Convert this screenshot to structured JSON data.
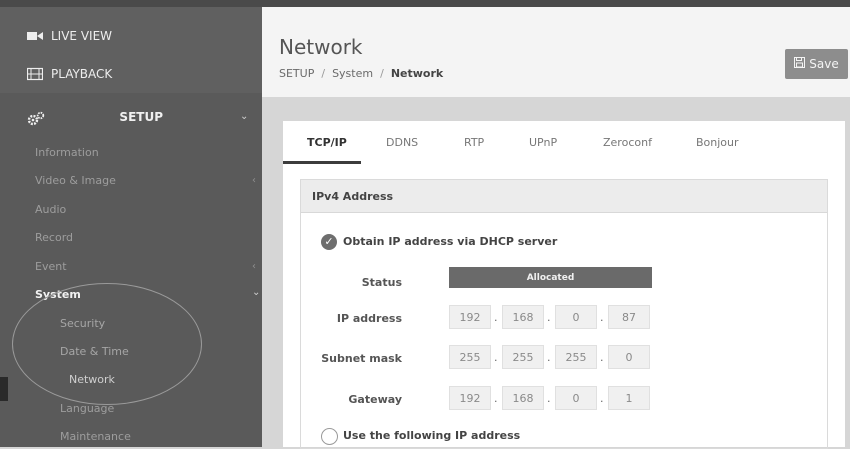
{
  "sidebar": {
    "live_view": "LIVE VIEW",
    "playback": "PLAYBACK",
    "setup": "SETUP",
    "items": [
      {
        "label": "Information"
      },
      {
        "label": "Video & Image"
      },
      {
        "label": "Audio"
      },
      {
        "label": "Record"
      },
      {
        "label": "Event"
      },
      {
        "label": "System"
      }
    ],
    "system_items": [
      {
        "label": "Security"
      },
      {
        "label": "Date & Time"
      },
      {
        "label": "Network"
      }
    ],
    "after": [
      {
        "label": "Language"
      },
      {
        "label": "Maintenance"
      }
    ]
  },
  "header": {
    "title": "Network",
    "breadcrumb": [
      "SETUP",
      "System",
      "Network"
    ],
    "save_label": "Save"
  },
  "tabs": [
    "TCP/IP",
    "DDNS",
    "RTP",
    "UPnP",
    "Zeroconf",
    "Bonjour"
  ],
  "ipv4": {
    "heading": "IPv4 Address",
    "dhcp_label": "Obtain IP address via DHCP server",
    "status_label": "Status",
    "status_value": "Allocated",
    "ip_label": "IP address",
    "ip": [
      "192",
      "168",
      "0",
      "87"
    ],
    "subnet_label": "Subnet mask",
    "subnet": [
      "255",
      "255",
      "255",
      "0"
    ],
    "gateway_label": "Gateway",
    "gateway": [
      "192",
      "168",
      "0",
      "1"
    ],
    "static_label": "Use the following IP address"
  },
  "colors": {
    "sidebar_bg": "#5a5a5a",
    "accent": "#6e6e6e",
    "save_button": "#8d8d8d"
  }
}
